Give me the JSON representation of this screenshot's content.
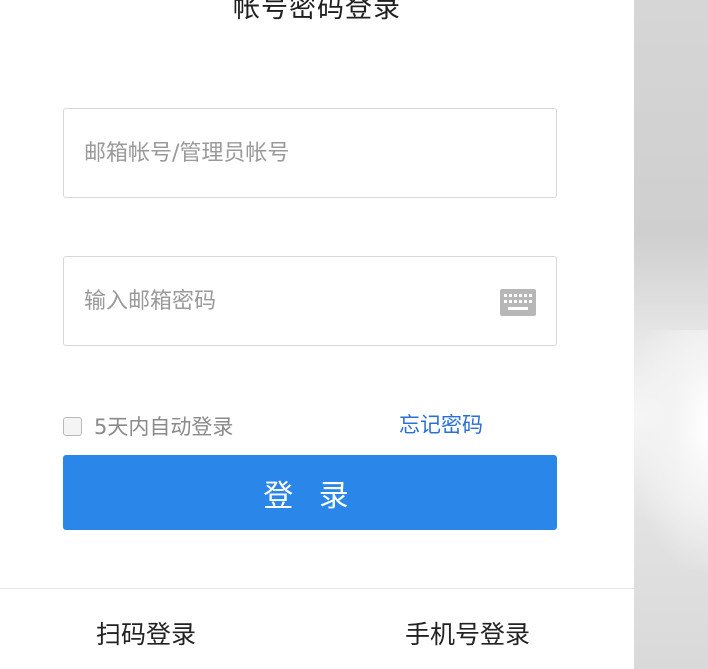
{
  "title": "帐号密码登录",
  "account_field": {
    "placeholder": "邮箱帐号/管理员帐号",
    "value": ""
  },
  "password_field": {
    "placeholder": "输入邮箱密码",
    "value": "",
    "keyboard_icon": "keyboard-icon"
  },
  "remember": {
    "label": "5天内自动登录",
    "checked": false
  },
  "forgot_password": "忘记密码",
  "login_button": "登 录",
  "footer": {
    "qr_login": "扫码登录",
    "phone_login": "手机号登录"
  },
  "colors": {
    "accent": "#2b86ea",
    "link": "#2a6fd6"
  }
}
